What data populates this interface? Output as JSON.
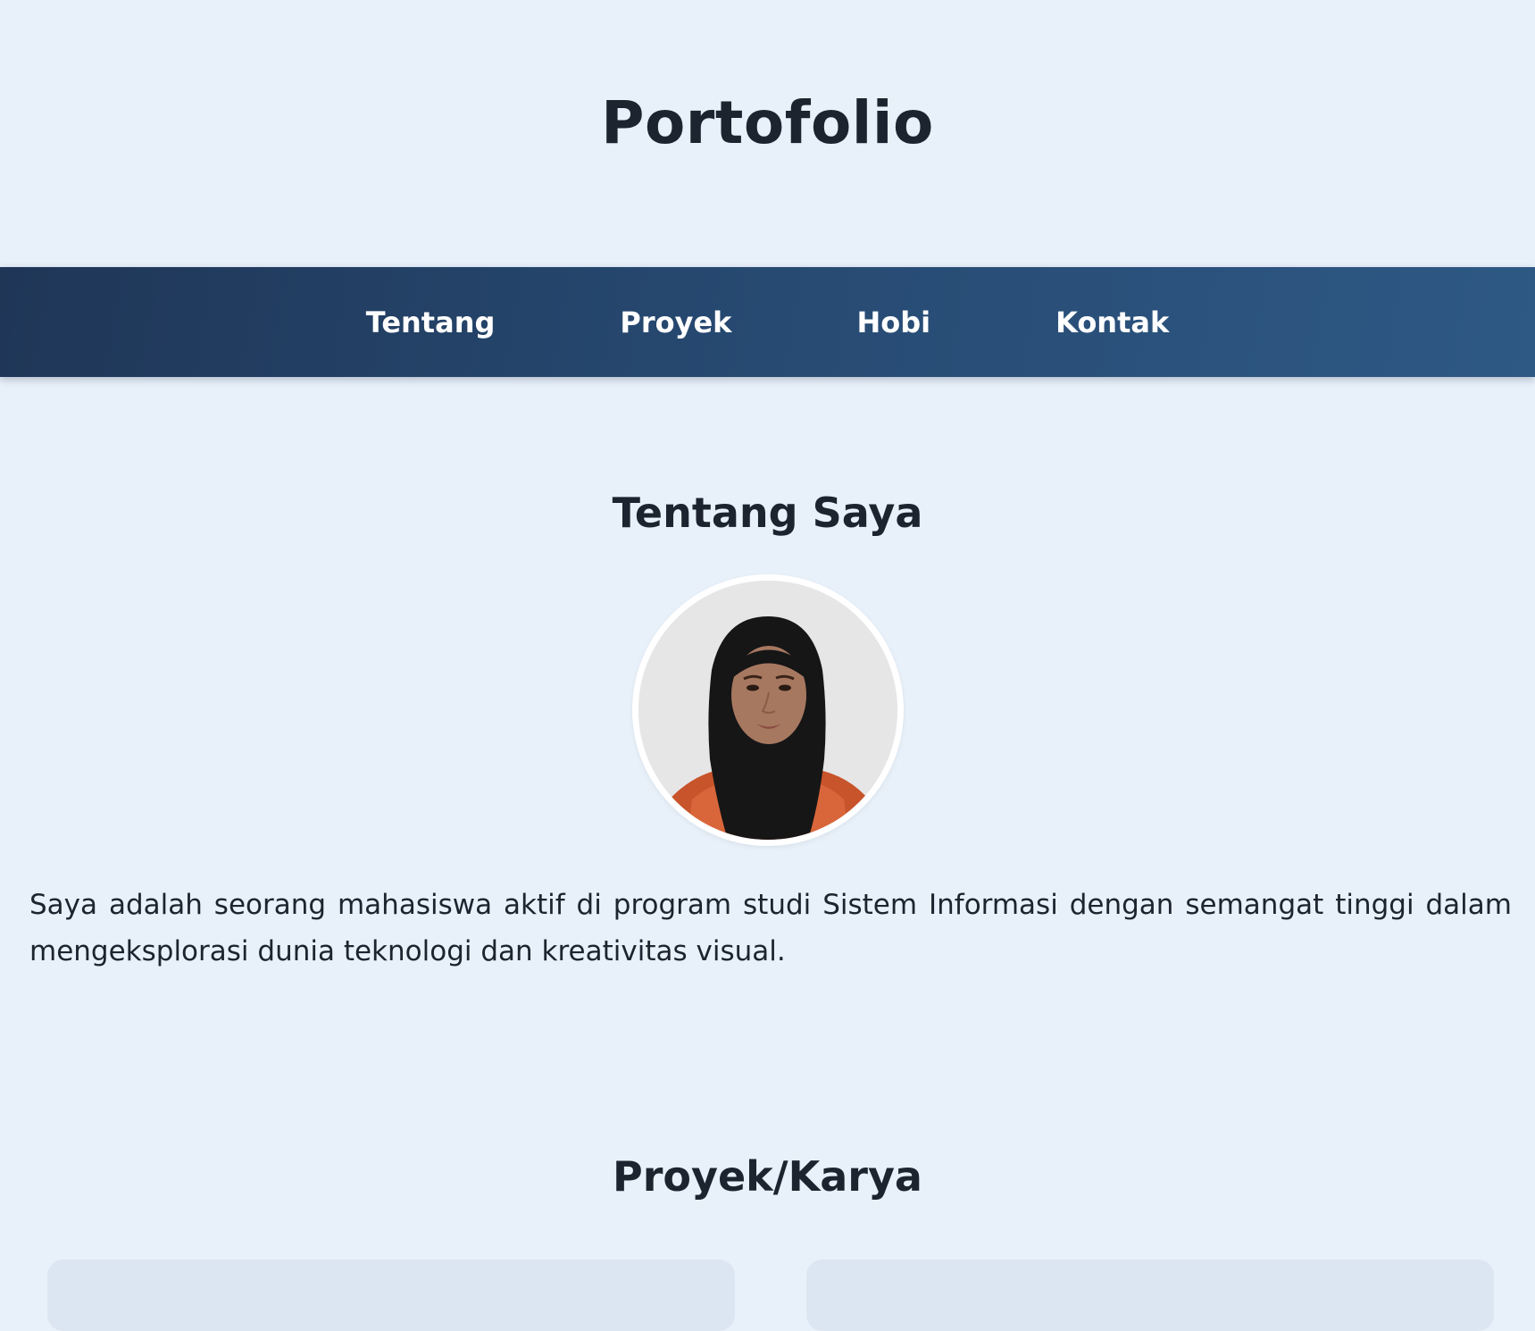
{
  "header": {
    "title": "Portofolio"
  },
  "nav": {
    "items": [
      {
        "label": "Tentang"
      },
      {
        "label": "Proyek"
      },
      {
        "label": "Hobi"
      },
      {
        "label": "Kontak"
      }
    ]
  },
  "about": {
    "title": "Tentang Saya",
    "photo_icon": "profile-photo",
    "text": "Saya adalah seorang mahasiswa aktif di program studi Sistem Informasi dengan semangat tinggi dalam mengeksplorasi dunia teknologi dan kreativitas visual."
  },
  "projects": {
    "title": "Proyek/Karya"
  },
  "colors": {
    "background": "#e8f0f9",
    "nav_start": "#1f3657",
    "nav_end": "#2e5985",
    "text": "#1c2430",
    "card": "#dce6f2"
  }
}
